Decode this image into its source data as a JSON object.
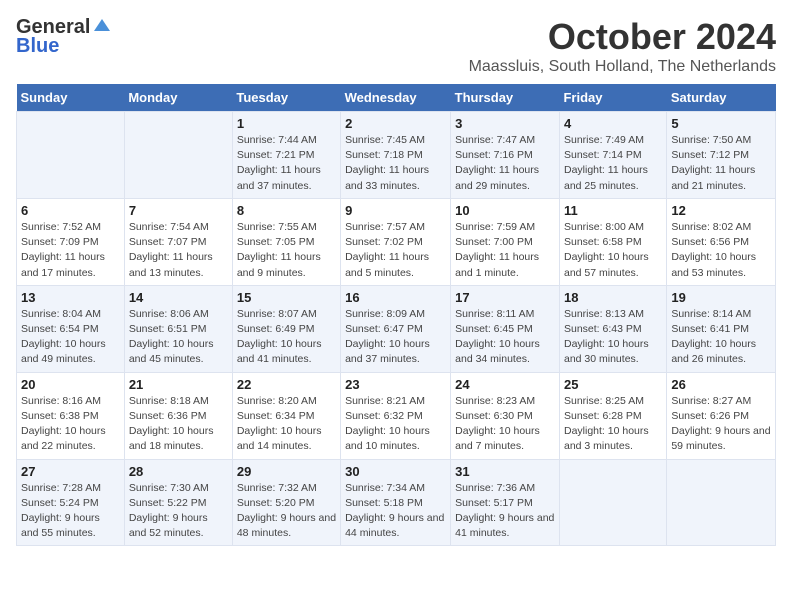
{
  "header": {
    "logo_general": "General",
    "logo_blue": "Blue",
    "month": "October 2024",
    "location": "Maassluis, South Holland, The Netherlands"
  },
  "weekdays": [
    "Sunday",
    "Monday",
    "Tuesday",
    "Wednesday",
    "Thursday",
    "Friday",
    "Saturday"
  ],
  "weeks": [
    [
      {
        "day": "",
        "info": ""
      },
      {
        "day": "",
        "info": ""
      },
      {
        "day": "1",
        "info": "Sunrise: 7:44 AM\nSunset: 7:21 PM\nDaylight: 11 hours and 37 minutes."
      },
      {
        "day": "2",
        "info": "Sunrise: 7:45 AM\nSunset: 7:18 PM\nDaylight: 11 hours and 33 minutes."
      },
      {
        "day": "3",
        "info": "Sunrise: 7:47 AM\nSunset: 7:16 PM\nDaylight: 11 hours and 29 minutes."
      },
      {
        "day": "4",
        "info": "Sunrise: 7:49 AM\nSunset: 7:14 PM\nDaylight: 11 hours and 25 minutes."
      },
      {
        "day": "5",
        "info": "Sunrise: 7:50 AM\nSunset: 7:12 PM\nDaylight: 11 hours and 21 minutes."
      }
    ],
    [
      {
        "day": "6",
        "info": "Sunrise: 7:52 AM\nSunset: 7:09 PM\nDaylight: 11 hours and 17 minutes."
      },
      {
        "day": "7",
        "info": "Sunrise: 7:54 AM\nSunset: 7:07 PM\nDaylight: 11 hours and 13 minutes."
      },
      {
        "day": "8",
        "info": "Sunrise: 7:55 AM\nSunset: 7:05 PM\nDaylight: 11 hours and 9 minutes."
      },
      {
        "day": "9",
        "info": "Sunrise: 7:57 AM\nSunset: 7:02 PM\nDaylight: 11 hours and 5 minutes."
      },
      {
        "day": "10",
        "info": "Sunrise: 7:59 AM\nSunset: 7:00 PM\nDaylight: 11 hours and 1 minute."
      },
      {
        "day": "11",
        "info": "Sunrise: 8:00 AM\nSunset: 6:58 PM\nDaylight: 10 hours and 57 minutes."
      },
      {
        "day": "12",
        "info": "Sunrise: 8:02 AM\nSunset: 6:56 PM\nDaylight: 10 hours and 53 minutes."
      }
    ],
    [
      {
        "day": "13",
        "info": "Sunrise: 8:04 AM\nSunset: 6:54 PM\nDaylight: 10 hours and 49 minutes."
      },
      {
        "day": "14",
        "info": "Sunrise: 8:06 AM\nSunset: 6:51 PM\nDaylight: 10 hours and 45 minutes."
      },
      {
        "day": "15",
        "info": "Sunrise: 8:07 AM\nSunset: 6:49 PM\nDaylight: 10 hours and 41 minutes."
      },
      {
        "day": "16",
        "info": "Sunrise: 8:09 AM\nSunset: 6:47 PM\nDaylight: 10 hours and 37 minutes."
      },
      {
        "day": "17",
        "info": "Sunrise: 8:11 AM\nSunset: 6:45 PM\nDaylight: 10 hours and 34 minutes."
      },
      {
        "day": "18",
        "info": "Sunrise: 8:13 AM\nSunset: 6:43 PM\nDaylight: 10 hours and 30 minutes."
      },
      {
        "day": "19",
        "info": "Sunrise: 8:14 AM\nSunset: 6:41 PM\nDaylight: 10 hours and 26 minutes."
      }
    ],
    [
      {
        "day": "20",
        "info": "Sunrise: 8:16 AM\nSunset: 6:38 PM\nDaylight: 10 hours and 22 minutes."
      },
      {
        "day": "21",
        "info": "Sunrise: 8:18 AM\nSunset: 6:36 PM\nDaylight: 10 hours and 18 minutes."
      },
      {
        "day": "22",
        "info": "Sunrise: 8:20 AM\nSunset: 6:34 PM\nDaylight: 10 hours and 14 minutes."
      },
      {
        "day": "23",
        "info": "Sunrise: 8:21 AM\nSunset: 6:32 PM\nDaylight: 10 hours and 10 minutes."
      },
      {
        "day": "24",
        "info": "Sunrise: 8:23 AM\nSunset: 6:30 PM\nDaylight: 10 hours and 7 minutes."
      },
      {
        "day": "25",
        "info": "Sunrise: 8:25 AM\nSunset: 6:28 PM\nDaylight: 10 hours and 3 minutes."
      },
      {
        "day": "26",
        "info": "Sunrise: 8:27 AM\nSunset: 6:26 PM\nDaylight: 9 hours and 59 minutes."
      }
    ],
    [
      {
        "day": "27",
        "info": "Sunrise: 7:28 AM\nSunset: 5:24 PM\nDaylight: 9 hours and 55 minutes."
      },
      {
        "day": "28",
        "info": "Sunrise: 7:30 AM\nSunset: 5:22 PM\nDaylight: 9 hours and 52 minutes."
      },
      {
        "day": "29",
        "info": "Sunrise: 7:32 AM\nSunset: 5:20 PM\nDaylight: 9 hours and 48 minutes."
      },
      {
        "day": "30",
        "info": "Sunrise: 7:34 AM\nSunset: 5:18 PM\nDaylight: 9 hours and 44 minutes."
      },
      {
        "day": "31",
        "info": "Sunrise: 7:36 AM\nSunset: 5:17 PM\nDaylight: 9 hours and 41 minutes."
      },
      {
        "day": "",
        "info": ""
      },
      {
        "day": "",
        "info": ""
      }
    ]
  ]
}
